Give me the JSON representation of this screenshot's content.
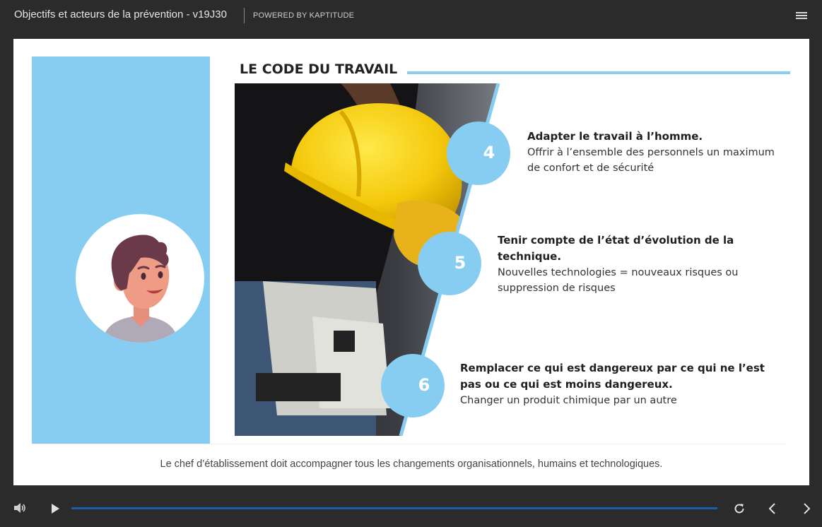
{
  "header": {
    "course_title": "Objectifs et acteurs de la prévention - v19J30",
    "powered_by": "POWERED BY KAPTITUDE",
    "menu_icon": "hamburger-menu-icon"
  },
  "slide": {
    "heading": "LE CODE DU TRAVAIL",
    "steps": [
      {
        "number": "4",
        "title": "Adapter le travail à l’homme.",
        "description": "Offrir à l’ensemble des personnels un maximum de confort et de sécurité"
      },
      {
        "number": "5",
        "title": "Tenir compte de l’état d’évolution de la technique.",
        "description": "Nouvelles technologies = nouveaux risques ou suppression de risques"
      },
      {
        "number": "6",
        "title": "Remplacer ce qui est dangereux par ce qui ne l’est pas ou ce qui est moins dangereux.",
        "description": "Changer un produit chimique par un autre"
      }
    ],
    "footer": "Le chef d’établissement doit accompagner tous les changements organisationnels, humains et technologiques."
  },
  "colors": {
    "accent": "#87cdf2",
    "progress": "#1b5ca8",
    "chrome": "#2b2b2b"
  },
  "controls": {
    "icons": [
      "volume-icon",
      "play-icon",
      "replay-icon",
      "previous-icon",
      "next-icon"
    ]
  }
}
